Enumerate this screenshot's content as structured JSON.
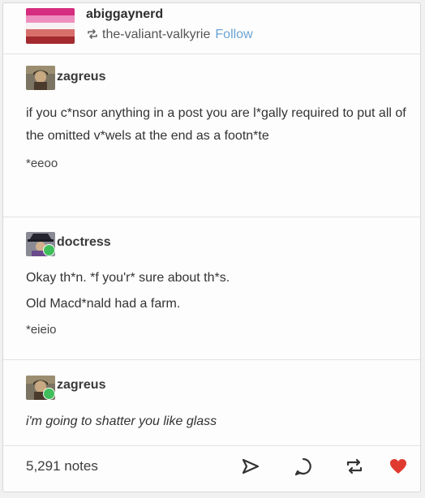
{
  "header": {
    "username": "abiggaynerd",
    "reblogged_from": "the-valiant-valkyrie",
    "follow_label": "Follow"
  },
  "posts": [
    {
      "username": "zagreus",
      "lines": [
        "if you c*nsor anything in a post you are l*gally required to put all of the omitted v*wels at the end as a footn*te"
      ],
      "footnote": "*eeoo"
    },
    {
      "username": "doctress",
      "lines": [
        "Okay th*n. *f you'r* sure about th*s.",
        "Old Macd*nald had a farm."
      ],
      "footnote": "*eieio"
    },
    {
      "username": "zagreus",
      "lines": [
        "i'm going to shatter you like glass"
      ]
    }
  ],
  "footer": {
    "notes_count": "5,291 notes",
    "icons": [
      "share-icon",
      "reply-icon",
      "reblog-icon",
      "like-icon"
    ]
  },
  "colors": {
    "follow": "#6aa3d4",
    "like": "#e0392f",
    "badge": "#3fbe5b"
  }
}
